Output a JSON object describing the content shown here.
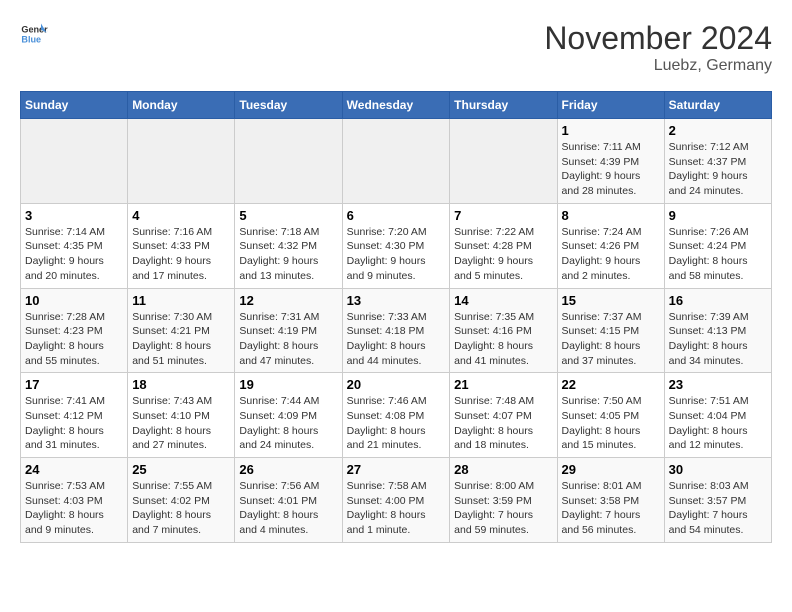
{
  "header": {
    "logo_general": "General",
    "logo_blue": "Blue",
    "title": "November 2024",
    "subtitle": "Luebz, Germany"
  },
  "calendar": {
    "days_of_week": [
      "Sunday",
      "Monday",
      "Tuesday",
      "Wednesday",
      "Thursday",
      "Friday",
      "Saturday"
    ],
    "weeks": [
      [
        {
          "day": "",
          "info": ""
        },
        {
          "day": "",
          "info": ""
        },
        {
          "day": "",
          "info": ""
        },
        {
          "day": "",
          "info": ""
        },
        {
          "day": "",
          "info": ""
        },
        {
          "day": "1",
          "info": "Sunrise: 7:11 AM\nSunset: 4:39 PM\nDaylight: 9 hours and 28 minutes."
        },
        {
          "day": "2",
          "info": "Sunrise: 7:12 AM\nSunset: 4:37 PM\nDaylight: 9 hours and 24 minutes."
        }
      ],
      [
        {
          "day": "3",
          "info": "Sunrise: 7:14 AM\nSunset: 4:35 PM\nDaylight: 9 hours and 20 minutes."
        },
        {
          "day": "4",
          "info": "Sunrise: 7:16 AM\nSunset: 4:33 PM\nDaylight: 9 hours and 17 minutes."
        },
        {
          "day": "5",
          "info": "Sunrise: 7:18 AM\nSunset: 4:32 PM\nDaylight: 9 hours and 13 minutes."
        },
        {
          "day": "6",
          "info": "Sunrise: 7:20 AM\nSunset: 4:30 PM\nDaylight: 9 hours and 9 minutes."
        },
        {
          "day": "7",
          "info": "Sunrise: 7:22 AM\nSunset: 4:28 PM\nDaylight: 9 hours and 5 minutes."
        },
        {
          "day": "8",
          "info": "Sunrise: 7:24 AM\nSunset: 4:26 PM\nDaylight: 9 hours and 2 minutes."
        },
        {
          "day": "9",
          "info": "Sunrise: 7:26 AM\nSunset: 4:24 PM\nDaylight: 8 hours and 58 minutes."
        }
      ],
      [
        {
          "day": "10",
          "info": "Sunrise: 7:28 AM\nSunset: 4:23 PM\nDaylight: 8 hours and 55 minutes."
        },
        {
          "day": "11",
          "info": "Sunrise: 7:30 AM\nSunset: 4:21 PM\nDaylight: 8 hours and 51 minutes."
        },
        {
          "day": "12",
          "info": "Sunrise: 7:31 AM\nSunset: 4:19 PM\nDaylight: 8 hours and 47 minutes."
        },
        {
          "day": "13",
          "info": "Sunrise: 7:33 AM\nSunset: 4:18 PM\nDaylight: 8 hours and 44 minutes."
        },
        {
          "day": "14",
          "info": "Sunrise: 7:35 AM\nSunset: 4:16 PM\nDaylight: 8 hours and 41 minutes."
        },
        {
          "day": "15",
          "info": "Sunrise: 7:37 AM\nSunset: 4:15 PM\nDaylight: 8 hours and 37 minutes."
        },
        {
          "day": "16",
          "info": "Sunrise: 7:39 AM\nSunset: 4:13 PM\nDaylight: 8 hours and 34 minutes."
        }
      ],
      [
        {
          "day": "17",
          "info": "Sunrise: 7:41 AM\nSunset: 4:12 PM\nDaylight: 8 hours and 31 minutes."
        },
        {
          "day": "18",
          "info": "Sunrise: 7:43 AM\nSunset: 4:10 PM\nDaylight: 8 hours and 27 minutes."
        },
        {
          "day": "19",
          "info": "Sunrise: 7:44 AM\nSunset: 4:09 PM\nDaylight: 8 hours and 24 minutes."
        },
        {
          "day": "20",
          "info": "Sunrise: 7:46 AM\nSunset: 4:08 PM\nDaylight: 8 hours and 21 minutes."
        },
        {
          "day": "21",
          "info": "Sunrise: 7:48 AM\nSunset: 4:07 PM\nDaylight: 8 hours and 18 minutes."
        },
        {
          "day": "22",
          "info": "Sunrise: 7:50 AM\nSunset: 4:05 PM\nDaylight: 8 hours and 15 minutes."
        },
        {
          "day": "23",
          "info": "Sunrise: 7:51 AM\nSunset: 4:04 PM\nDaylight: 8 hours and 12 minutes."
        }
      ],
      [
        {
          "day": "24",
          "info": "Sunrise: 7:53 AM\nSunset: 4:03 PM\nDaylight: 8 hours and 9 minutes."
        },
        {
          "day": "25",
          "info": "Sunrise: 7:55 AM\nSunset: 4:02 PM\nDaylight: 8 hours and 7 minutes."
        },
        {
          "day": "26",
          "info": "Sunrise: 7:56 AM\nSunset: 4:01 PM\nDaylight: 8 hours and 4 minutes."
        },
        {
          "day": "27",
          "info": "Sunrise: 7:58 AM\nSunset: 4:00 PM\nDaylight: 8 hours and 1 minute."
        },
        {
          "day": "28",
          "info": "Sunrise: 8:00 AM\nSunset: 3:59 PM\nDaylight: 7 hours and 59 minutes."
        },
        {
          "day": "29",
          "info": "Sunrise: 8:01 AM\nSunset: 3:58 PM\nDaylight: 7 hours and 56 minutes."
        },
        {
          "day": "30",
          "info": "Sunrise: 8:03 AM\nSunset: 3:57 PM\nDaylight: 7 hours and 54 minutes."
        }
      ]
    ]
  }
}
